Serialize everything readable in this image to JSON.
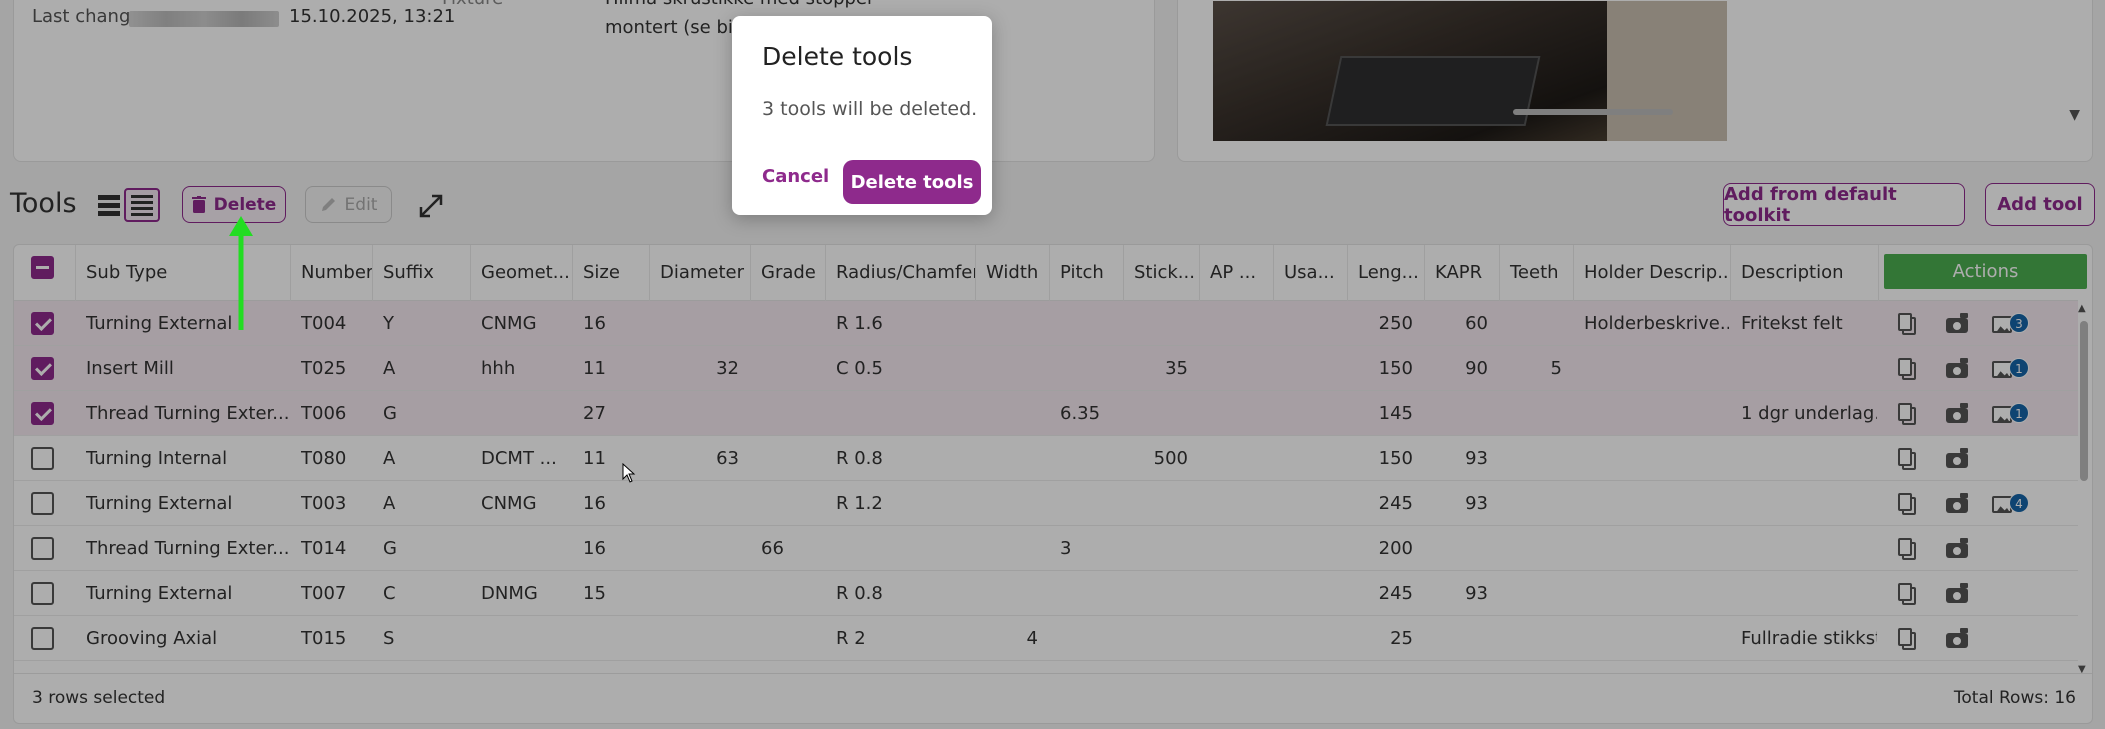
{
  "info": {
    "last_change_label": "Last change",
    "last_change_date": "15.10.2025, 13:21",
    "fixture_label": "Fixture",
    "fixture_text_1": "Hilma skrustikke med stopper",
    "fixture_text_2": "montert (se bilde"
  },
  "toolbar": {
    "title": "Tools",
    "delete_label": "Delete",
    "edit_label": "Edit",
    "add_from_default_label": "Add from default toolkit",
    "add_tool_label": "Add tool"
  },
  "table": {
    "columns": [
      "Sub Type",
      "Number",
      "Suffix",
      "Geomet...",
      "Size",
      "Diameter",
      "Grade",
      "Radius/Chamfer",
      "Width",
      "Pitch",
      "Stick...",
      "AP ...",
      "Usa...",
      "Leng...",
      "KAPR",
      "Teeth",
      "Holder Descrip...",
      "Description"
    ],
    "actions_label": "Actions",
    "rows": [
      {
        "selected": true,
        "sub_type": "Turning External",
        "number": "T004",
        "suffix": "Y",
        "geometry": "CNMG",
        "size": "16",
        "diameter": "",
        "grade": "",
        "radius": "R 1.6",
        "width": "",
        "pitch": "",
        "stick": "",
        "ap": "",
        "usage": "",
        "length": "250",
        "kapr": "60",
        "teeth": "",
        "holder": "Holderbeskrive...",
        "description": "Fritekst felt",
        "images": "3"
      },
      {
        "selected": true,
        "sub_type": "Insert Mill",
        "number": "T025",
        "suffix": "A",
        "geometry": "hhh",
        "size": "11",
        "diameter": "32",
        "grade": "",
        "radius": "C 0.5",
        "width": "",
        "pitch": "",
        "stick": "35",
        "ap": "",
        "usage": "",
        "length": "150",
        "kapr": "90",
        "teeth": "5",
        "holder": "",
        "description": "",
        "images": "1"
      },
      {
        "selected": true,
        "sub_type": "Thread Turning Exter...",
        "number": "T006",
        "suffix": "G",
        "geometry": "",
        "size": "27",
        "diameter": "",
        "grade": "",
        "radius": "",
        "width": "",
        "pitch": "6.35",
        "stick": "",
        "ap": "",
        "usage": "",
        "length": "145",
        "kapr": "",
        "teeth": "",
        "holder": "",
        "description": "1 dgr underlag...",
        "images": "1"
      },
      {
        "selected": false,
        "sub_type": "Turning Internal",
        "number": "T080",
        "suffix": "A",
        "geometry": "DCMT ...",
        "size": "11",
        "diameter": "63",
        "grade": "",
        "radius": "R 0.8",
        "width": "",
        "pitch": "",
        "stick": "500",
        "ap": "",
        "usage": "",
        "length": "150",
        "kapr": "93",
        "teeth": "",
        "holder": "",
        "description": "",
        "images": ""
      },
      {
        "selected": false,
        "sub_type": "Turning External",
        "number": "T003",
        "suffix": "A",
        "geometry": "CNMG",
        "size": "16",
        "diameter": "",
        "grade": "",
        "radius": "R 1.2",
        "width": "",
        "pitch": "",
        "stick": "",
        "ap": "",
        "usage": "",
        "length": "245",
        "kapr": "93",
        "teeth": "",
        "holder": "",
        "description": "",
        "images": "4"
      },
      {
        "selected": false,
        "sub_type": "Thread Turning Exter...",
        "number": "T014",
        "suffix": "G",
        "geometry": "",
        "size": "16",
        "diameter": "",
        "grade": "66",
        "radius": "",
        "width": "",
        "pitch": "3",
        "stick": "",
        "ap": "",
        "usage": "",
        "length": "200",
        "kapr": "",
        "teeth": "",
        "holder": "",
        "description": "",
        "images": ""
      },
      {
        "selected": false,
        "sub_type": "Turning External",
        "number": "T007",
        "suffix": "C",
        "geometry": "DNMG",
        "size": "15",
        "diameter": "",
        "grade": "",
        "radius": "R 0.8",
        "width": "",
        "pitch": "",
        "stick": "",
        "ap": "",
        "usage": "",
        "length": "245",
        "kapr": "93",
        "teeth": "",
        "holder": "",
        "description": "",
        "images": ""
      },
      {
        "selected": false,
        "sub_type": "Grooving Axial",
        "number": "T015",
        "suffix": "S",
        "geometry": "",
        "size": "",
        "diameter": "",
        "grade": "",
        "radius": "R 2",
        "width": "4",
        "pitch": "",
        "stick": "",
        "ap": "",
        "usage": "",
        "length": "25",
        "kapr": "",
        "teeth": "",
        "holder": "",
        "description": "Fullradie stikkstål",
        "images": ""
      }
    ]
  },
  "footer": {
    "rows_selected": "3 rows selected",
    "total_rows": "Total Rows: 16"
  },
  "dialog": {
    "title": "Delete tools",
    "message": "3 tools will be deleted.",
    "cancel_label": "Cancel",
    "confirm_label": "Delete tools"
  },
  "colors": {
    "accent": "#8e2a8c",
    "actions_header": "#4caf50",
    "badge": "#1565a8",
    "annotation_arrow": "#22dd22"
  }
}
